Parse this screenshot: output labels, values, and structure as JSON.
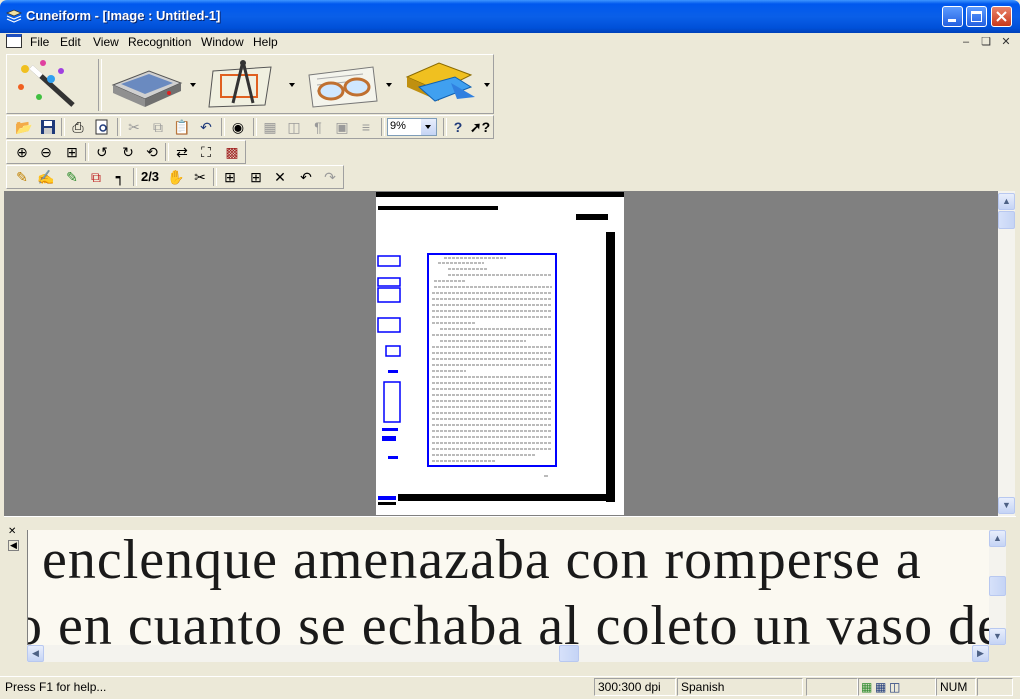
{
  "window": {
    "title": "Cuneiform - [Image : Untitled-1]"
  },
  "menu": {
    "items": [
      "File",
      "Edit",
      "View",
      "Recognition",
      "Window",
      "Help"
    ]
  },
  "toolbar": {
    "zoom_value": "9%"
  },
  "document": {
    "text_lines": [
      "enclenque amenazaba con romperse a",
      "o en cuanto se echaba al coleto un vaso de"
    ]
  },
  "statusbar": {
    "help": "Press F1 for help...",
    "dpi": "300:300 dpi",
    "language": "Spanish",
    "num": "NUM"
  },
  "colors": {
    "titlebar": "#0a5fe8",
    "selection": "#0000ff",
    "workspace": "#808080"
  }
}
